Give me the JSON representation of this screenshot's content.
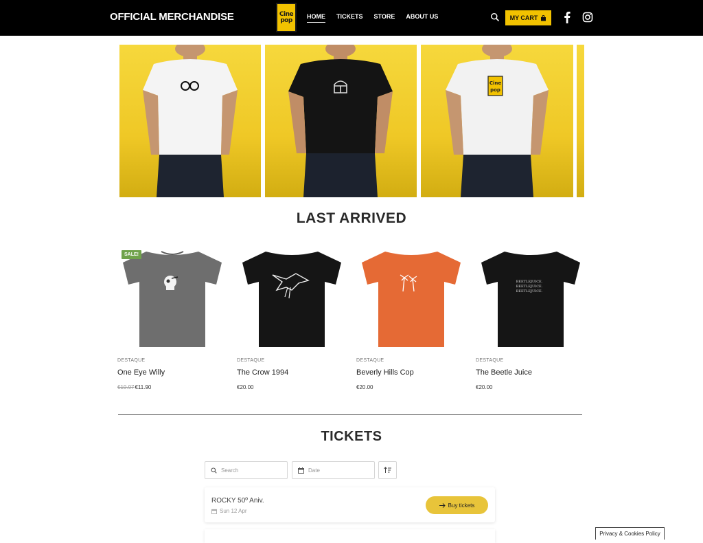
{
  "header": {
    "site_title": "OFFICIAL MERCHANDISE",
    "logo_line1": "Cine",
    "logo_line2": "pop",
    "nav": [
      "HOME",
      "TICKETS",
      "STORE",
      "ABOUT US"
    ],
    "cart_label": "MY CART",
    "icons": [
      "search-icon",
      "bag-icon",
      "facebook-icon",
      "instagram-icon"
    ]
  },
  "hero": {
    "slides": [
      {
        "shirt": "white",
        "print": "infinity-snake"
      },
      {
        "shirt": "black",
        "print": "helmet"
      },
      {
        "shirt": "white",
        "print": "cinepop-logo"
      },
      {
        "shirt": "partial",
        "print": ""
      }
    ]
  },
  "last_arrived": {
    "title": "LAST ARRIVED",
    "products": [
      {
        "badge": "SALE!",
        "category": "DESTAQUE",
        "name": "One Eye Willy",
        "old_price": "€19.97",
        "price": "€11.90",
        "color": "#6e6e6e",
        "print": "skull"
      },
      {
        "badge": "",
        "category": "DESTAQUE",
        "name": "The Crow 1994",
        "old_price": "",
        "price": "€20.00",
        "color": "#151515",
        "print": "crow"
      },
      {
        "badge": "",
        "category": "DESTAQUE",
        "name": "Beverly Hills Cop",
        "old_price": "",
        "price": "€20.00",
        "color": "#e56a35",
        "print": "palms"
      },
      {
        "badge": "",
        "category": "DESTAQUE",
        "name": "The Beetle Juice",
        "old_price": "",
        "price": "€20.00",
        "color": "#151515",
        "print": "text",
        "print_text": "BEETLEJUICE."
      }
    ]
  },
  "tickets": {
    "title": "TICKETS",
    "search_placeholder": "Search",
    "date_placeholder": "Date",
    "events": [
      {
        "title": "ROCKY 50º Aniv.",
        "date": "Sun 12 Apr",
        "button": "Buy tickets"
      }
    ]
  },
  "cookie_label": "Privacy & Cookies Policy",
  "colors": {
    "accent": "#f2c200",
    "sale": "#6fa24b",
    "button": "#e8c43a"
  }
}
